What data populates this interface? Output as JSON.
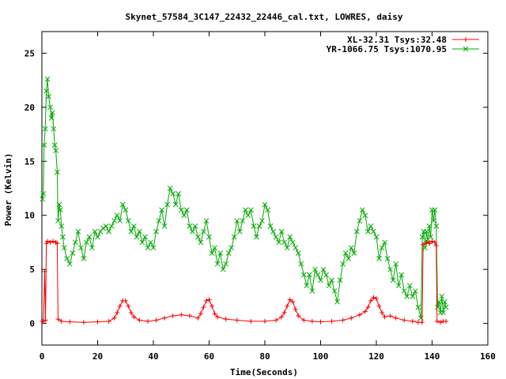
{
  "chart_data": {
    "type": "line",
    "title": "Skynet_57584_3C147_22432_22446_cal.txt, LOWRES, daisy",
    "xlabel": "Time(Seconds)",
    "ylabel": "Power (Kelvin)",
    "xlim": [
      0,
      160
    ],
    "ylim": [
      -2,
      27
    ],
    "xticks": [
      0,
      20,
      40,
      60,
      80,
      100,
      120,
      140,
      160
    ],
    "yticks": [
      0,
      5,
      10,
      15,
      20,
      25
    ],
    "grid": false,
    "legend_position": "top-right",
    "series": [
      {
        "name": "XL-32.31 Tsys:32.48",
        "color": "#ff0000",
        "marker": "plus",
        "points": [
          [
            0.2,
            0.2
          ],
          [
            0.6,
            0.2
          ],
          [
            1.0,
            4.8
          ],
          [
            1.3,
            0.3
          ],
          [
            1.6,
            7.4
          ],
          [
            2,
            7.6
          ],
          [
            3,
            7.5
          ],
          [
            4,
            7.6
          ],
          [
            5,
            7.5
          ],
          [
            5.5,
            7.4
          ],
          [
            5.8,
            0.4
          ],
          [
            7,
            0.2
          ],
          [
            10,
            0.15
          ],
          [
            15,
            0.1
          ],
          [
            20,
            0.15
          ],
          [
            24,
            0.2
          ],
          [
            26,
            0.5
          ],
          [
            27,
            1.0
          ],
          [
            28,
            1.6
          ],
          [
            29,
            2.1
          ],
          [
            30,
            2.1
          ],
          [
            31,
            1.6
          ],
          [
            32,
            1.0
          ],
          [
            33,
            0.6
          ],
          [
            35,
            0.3
          ],
          [
            38,
            0.2
          ],
          [
            41,
            0.3
          ],
          [
            44,
            0.5
          ],
          [
            47,
            0.7
          ],
          [
            50,
            0.8
          ],
          [
            53,
            0.7
          ],
          [
            56,
            0.5
          ],
          [
            57,
            0.9
          ],
          [
            58,
            1.5
          ],
          [
            59,
            2.1
          ],
          [
            60,
            2.2
          ],
          [
            61,
            1.6
          ],
          [
            62,
            0.9
          ],
          [
            63,
            0.6
          ],
          [
            66,
            0.4
          ],
          [
            70,
            0.3
          ],
          [
            75,
            0.2
          ],
          [
            80,
            0.2
          ],
          [
            84,
            0.3
          ],
          [
            86,
            0.6
          ],
          [
            87,
            1.0
          ],
          [
            88,
            1.6
          ],
          [
            89,
            2.2
          ],
          [
            90,
            2.0
          ],
          [
            91,
            1.3
          ],
          [
            92,
            0.7
          ],
          [
            94,
            0.3
          ],
          [
            97,
            0.2
          ],
          [
            100,
            0.15
          ],
          [
            104,
            0.2
          ],
          [
            108,
            0.3
          ],
          [
            111,
            0.5
          ],
          [
            114,
            0.8
          ],
          [
            116,
            1.1
          ],
          [
            117,
            1.5
          ],
          [
            118,
            2.1
          ],
          [
            119,
            2.4
          ],
          [
            120,
            2.3
          ],
          [
            121,
            1.6
          ],
          [
            122,
            1.0
          ],
          [
            123,
            0.6
          ],
          [
            125,
            0.7
          ],
          [
            127,
            0.5
          ],
          [
            130,
            0.3
          ],
          [
            133,
            0.2
          ],
          [
            135,
            0.1
          ],
          [
            136.4,
            0.1
          ],
          [
            136.8,
            7.3
          ],
          [
            138,
            7.5
          ],
          [
            139,
            7.4
          ],
          [
            140,
            7.6
          ],
          [
            141,
            7.5
          ],
          [
            141.5,
            7.2
          ],
          [
            141.8,
            0.2
          ],
          [
            143,
            0.1
          ],
          [
            144,
            0.2
          ],
          [
            145,
            0.2
          ]
        ]
      },
      {
        "name": "YR-1066.75 Tsys:1070.95",
        "color": "#00aa00",
        "marker": "cross",
        "points": [
          [
            0.2,
            11.5
          ],
          [
            0.5,
            12.0
          ],
          [
            0.8,
            16.5
          ],
          [
            1.2,
            18.0
          ],
          [
            1.6,
            21.5
          ],
          [
            2,
            22.6
          ],
          [
            2.4,
            21.0
          ],
          [
            3,
            20.0
          ],
          [
            3.4,
            19.0
          ],
          [
            3.8,
            19.5
          ],
          [
            4.2,
            18.0
          ],
          [
            4.6,
            16.5
          ],
          [
            5,
            16.0
          ],
          [
            5.5,
            14.0
          ],
          [
            5.8,
            9.5
          ],
          [
            6.2,
            11.0
          ],
          [
            6.6,
            10.5
          ],
          [
            7,
            9.0
          ],
          [
            7.5,
            8.0
          ],
          [
            8,
            7.0
          ],
          [
            9,
            6.0
          ],
          [
            10,
            5.5
          ],
          [
            11,
            6.5
          ],
          [
            12,
            7.5
          ],
          [
            13,
            8.5
          ],
          [
            14,
            7.0
          ],
          [
            15,
            6.0
          ],
          [
            16,
            7.5
          ],
          [
            17,
            8.0
          ],
          [
            18,
            7.0
          ],
          [
            19,
            8.5
          ],
          [
            20,
            8.0
          ],
          [
            21,
            8.5
          ],
          [
            22,
            8.8
          ],
          [
            23,
            9.0
          ],
          [
            24,
            8.5
          ],
          [
            25,
            9.0
          ],
          [
            26,
            9.5
          ],
          [
            27,
            10.0
          ],
          [
            28,
            9.5
          ],
          [
            29,
            11.0
          ],
          [
            30,
            10.5
          ],
          [
            31,
            9.5
          ],
          [
            32,
            8.5
          ],
          [
            33,
            9.0
          ],
          [
            34,
            8.0
          ],
          [
            35,
            8.5
          ],
          [
            36,
            7.5
          ],
          [
            37,
            8.0
          ],
          [
            38,
            7.0
          ],
          [
            39,
            7.5
          ],
          [
            40,
            7.0
          ],
          [
            41,
            8.5
          ],
          [
            42,
            9.5
          ],
          [
            43,
            10.5
          ],
          [
            44,
            9.0
          ],
          [
            45,
            11.0
          ],
          [
            46,
            12.5
          ],
          [
            47,
            12.0
          ],
          [
            48,
            11.0
          ],
          [
            49,
            12.0
          ],
          [
            50,
            10.5
          ],
          [
            51,
            10.0
          ],
          [
            52,
            10.5
          ],
          [
            53,
            9.0
          ],
          [
            54,
            8.5
          ],
          [
            55,
            9.0
          ],
          [
            56,
            8.0
          ],
          [
            57,
            7.5
          ],
          [
            58,
            8.5
          ],
          [
            59,
            9.5
          ],
          [
            60,
            8.0
          ],
          [
            61,
            6.5
          ],
          [
            62,
            7.0
          ],
          [
            63,
            5.5
          ],
          [
            64,
            6.5
          ],
          [
            65,
            5.0
          ],
          [
            66,
            5.5
          ],
          [
            67,
            6.5
          ],
          [
            68,
            7.0
          ],
          [
            69,
            8.0
          ],
          [
            70,
            9.5
          ],
          [
            71,
            8.5
          ],
          [
            72,
            9.5
          ],
          [
            73,
            10.5
          ],
          [
            74,
            10.0
          ],
          [
            75,
            10.5
          ],
          [
            76,
            9.0
          ],
          [
            77,
            8.0
          ],
          [
            78,
            9.0
          ],
          [
            79,
            9.5
          ],
          [
            80,
            11.0
          ],
          [
            81,
            10.5
          ],
          [
            82,
            9.0
          ],
          [
            83,
            8.5
          ],
          [
            84,
            8.0
          ],
          [
            85,
            7.5
          ],
          [
            86,
            8.5
          ],
          [
            87,
            7.5
          ],
          [
            88,
            7.0
          ],
          [
            89,
            8.0
          ],
          [
            90,
            7.5
          ],
          [
            91,
            7.0
          ],
          [
            92,
            6.5
          ],
          [
            93,
            5.5
          ],
          [
            94,
            4.5
          ],
          [
            95,
            3.5
          ],
          [
            96,
            4.5
          ],
          [
            97,
            3.0
          ],
          [
            98,
            5.0
          ],
          [
            99,
            4.5
          ],
          [
            100,
            4.0
          ],
          [
            101,
            5.0
          ],
          [
            102,
            4.5
          ],
          [
            103,
            3.5
          ],
          [
            104,
            4.0
          ],
          [
            105,
            3.0
          ],
          [
            106,
            2.0
          ],
          [
            107,
            4.0
          ],
          [
            108,
            5.5
          ],
          [
            109,
            6.5
          ],
          [
            110,
            6.0
          ],
          [
            111,
            7.0
          ],
          [
            112,
            6.5
          ],
          [
            113,
            8.5
          ],
          [
            114,
            9.5
          ],
          [
            115,
            10.5
          ],
          [
            116,
            10.0
          ],
          [
            117,
            8.5
          ],
          [
            118,
            9.0
          ],
          [
            119,
            8.5
          ],
          [
            120,
            8.0
          ],
          [
            121,
            6.0
          ],
          [
            122,
            7.0
          ],
          [
            123,
            7.5
          ],
          [
            124,
            6.0
          ],
          [
            125,
            5.0
          ],
          [
            126,
            4.0
          ],
          [
            127,
            5.5
          ],
          [
            128,
            3.5
          ],
          [
            129,
            4.5
          ],
          [
            130,
            3.0
          ],
          [
            131,
            2.5
          ],
          [
            132,
            3.5
          ],
          [
            133,
            2.5
          ],
          [
            134,
            3.0
          ],
          [
            135,
            1.5
          ],
          [
            136,
            0.5
          ],
          [
            136.5,
            8.0
          ],
          [
            137,
            8.5
          ],
          [
            137.5,
            7.0
          ],
          [
            138,
            8.5
          ],
          [
            138.5,
            7.5
          ],
          [
            139,
            9.0
          ],
          [
            139.5,
            8.0
          ],
          [
            140,
            10.5
          ],
          [
            140.5,
            9.5
          ],
          [
            141,
            10.5
          ],
          [
            141.5,
            9.0
          ],
          [
            142,
            1.5
          ],
          [
            142.5,
            2.0
          ],
          [
            143,
            1.0
          ],
          [
            143.5,
            2.5
          ],
          [
            144,
            1.0
          ],
          [
            144.5,
            2.0
          ],
          [
            145,
            1.5
          ]
        ]
      }
    ]
  }
}
